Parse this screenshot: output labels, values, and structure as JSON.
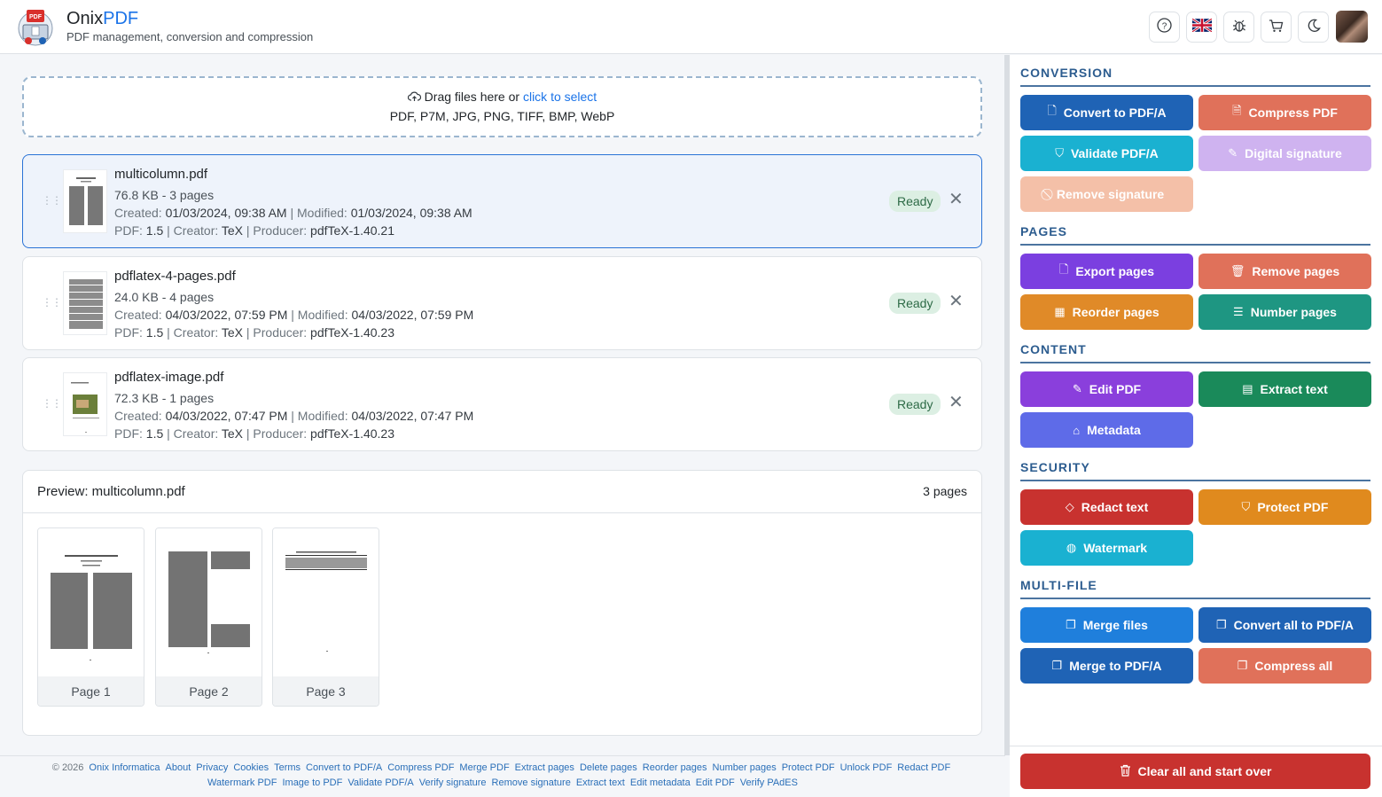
{
  "header": {
    "brand_part1": "Onix",
    "brand_part2": "PDF",
    "subtitle": "PDF management, conversion and compression",
    "buttons": [
      {
        "name": "help-icon",
        "glyph": "?"
      },
      {
        "name": "uk-flag-icon",
        "glyph": ""
      },
      {
        "name": "bug-icon",
        "glyph": "✱"
      },
      {
        "name": "cart-icon",
        "glyph": "🛒"
      },
      {
        "name": "moon-icon",
        "glyph": "☾"
      }
    ]
  },
  "dropzone": {
    "text": "Drag files here or",
    "link": "click to select",
    "formats": "PDF, P7M, JPG, PNG, TIFF, BMP, WebP"
  },
  "files": [
    {
      "name": "multicolumn.pdf",
      "size": "76.8 KB - 3 pages",
      "created_label": "Created:",
      "created": "01/03/2024, 09:38 AM",
      "modified_label": "| Modified:",
      "modified": "01/03/2024, 09:38 AM",
      "pdf_label": "PDF:",
      "pdf": "1.5",
      "creator_label": "| Creator:",
      "creator": "TeX",
      "producer_label": "| Producer:",
      "producer": "pdfTeX-1.40.21",
      "status": "Ready"
    },
    {
      "name": "pdflatex-4-pages.pdf",
      "size": "24.0 KB - 4 pages",
      "created_label": "Created:",
      "created": "04/03/2022, 07:59 PM",
      "modified_label": "| Modified:",
      "modified": "04/03/2022, 07:59 PM",
      "pdf_label": "PDF:",
      "pdf": "1.5",
      "creator_label": "| Creator:",
      "creator": "TeX",
      "producer_label": "| Producer:",
      "producer": "pdfTeX-1.40.23",
      "status": "Ready"
    },
    {
      "name": "pdflatex-image.pdf",
      "size": "72.3 KB - 1 pages",
      "created_label": "Created:",
      "created": "04/03/2022, 07:47 PM",
      "modified_label": "| Modified:",
      "modified": "04/03/2022, 07:47 PM",
      "pdf_label": "PDF:",
      "pdf": "1.5",
      "creator_label": "| Creator:",
      "creator": "TeX",
      "producer_label": "| Producer:",
      "producer": "pdfTeX-1.40.23",
      "status": "Ready"
    }
  ],
  "preview": {
    "title": "Preview: multicolumn.pdf",
    "count": "3 pages",
    "pages": [
      "Page 1",
      "Page 2",
      "Page 3"
    ]
  },
  "sidebar": {
    "sections": [
      {
        "title": "CONVERSION",
        "buttons": [
          {
            "label": "Convert to PDF/A",
            "icon": "file-icon",
            "glyph": "🗋",
            "color": "#1f63b5",
            "disabled": false
          },
          {
            "label": "Compress PDF",
            "icon": "file-zip-icon",
            "glyph": "🗎",
            "color": "#e0715a",
            "disabled": false
          },
          {
            "label": "Validate PDF/A",
            "icon": "shield-check-icon",
            "glyph": "⛉",
            "color": "#1ab1d1",
            "disabled": false
          },
          {
            "label": "Digital signature",
            "icon": "pen-icon",
            "glyph": "✎",
            "color": "#cfb3f0",
            "disabled": true
          },
          {
            "label": "Remove signature",
            "icon": "shield-slash-icon",
            "glyph": "⃠",
            "color": "#f4c0a8",
            "disabled": true
          }
        ]
      },
      {
        "title": "PAGES",
        "buttons": [
          {
            "label": "Export pages",
            "icon": "file-export-icon",
            "glyph": "🗋",
            "color": "#7b3fe0",
            "disabled": false
          },
          {
            "label": "Remove pages",
            "icon": "trash-icon",
            "glyph": "🗑",
            "color": "#e0715a",
            "disabled": false
          },
          {
            "label": "Reorder pages",
            "icon": "grid-icon",
            "glyph": "▦",
            "color": "#e08a28",
            "disabled": false
          },
          {
            "label": "Number pages",
            "icon": "list-icon",
            "glyph": "☰",
            "color": "#1e9682",
            "disabled": false
          }
        ]
      },
      {
        "title": "CONTENT",
        "buttons": [
          {
            "label": "Edit PDF",
            "icon": "edit-icon",
            "glyph": "✎",
            "color": "#8a3fdc",
            "disabled": false
          },
          {
            "label": "Extract text",
            "icon": "text-icon",
            "glyph": "▤",
            "color": "#1a8a5a",
            "disabled": false
          },
          {
            "label": "Metadata",
            "icon": "tag-icon",
            "glyph": "⌂",
            "color": "#5e6be8",
            "disabled": false
          }
        ]
      },
      {
        "title": "SECURITY",
        "buttons": [
          {
            "label": "Redact text",
            "icon": "eraser-icon",
            "glyph": "◇",
            "color": "#c8322f",
            "disabled": false
          },
          {
            "label": "Protect PDF",
            "icon": "shield-icon",
            "glyph": "⛉",
            "color": "#e08a1e",
            "disabled": false
          },
          {
            "label": "Watermark",
            "icon": "droplet-icon",
            "glyph": "◍",
            "color": "#1ab1d1",
            "disabled": false
          }
        ]
      },
      {
        "title": "MULTI-FILE",
        "buttons": [
          {
            "label": "Merge files",
            "icon": "files-icon",
            "glyph": "❐",
            "color": "#1f7fdc",
            "disabled": false
          },
          {
            "label": "Convert all to PDF/A",
            "icon": "copy-icon",
            "glyph": "❐",
            "color": "#1f63b5",
            "disabled": false
          },
          {
            "label": "Merge to PDF/A",
            "icon": "files-icon",
            "glyph": "❐",
            "color": "#1f63b5",
            "disabled": false
          },
          {
            "label": "Compress all",
            "icon": "copy-icon",
            "glyph": "❐",
            "color": "#e0715a",
            "disabled": false
          }
        ]
      }
    ],
    "clear_label": "Clear all and start over"
  },
  "footer": {
    "row1": [
      "© 2026",
      "Onix Informatica",
      "About",
      "Privacy",
      "Cookies",
      "Terms",
      "Convert to PDF/A",
      "Compress PDF",
      "Merge PDF",
      "Extract pages",
      "Delete pages",
      "Reorder pages",
      "Number pages",
      "Protect PDF",
      "Unlock PDF",
      "Redact PDF"
    ],
    "row2": [
      "Watermark PDF",
      "Image to PDF",
      "Validate PDF/A",
      "Verify signature",
      "Remove signature",
      "Extract text",
      "Edit metadata",
      "Edit PDF",
      "Verify PAdES"
    ]
  }
}
